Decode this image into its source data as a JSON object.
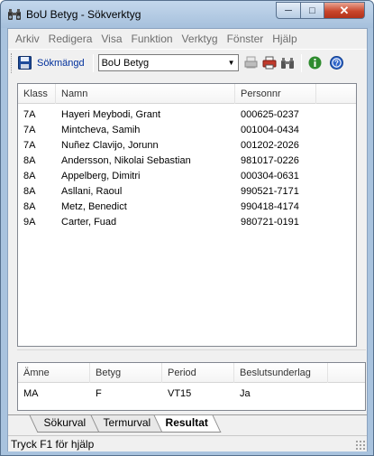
{
  "window": {
    "title": "BoU Betyg - Sökverktyg",
    "minimize_label": "─",
    "maximize_label": "□",
    "close_label": "✕"
  },
  "menubar": {
    "items": [
      "Arkiv",
      "Redigera",
      "Visa",
      "Funktion",
      "Verktyg",
      "Fönster",
      "Hjälp"
    ]
  },
  "toolbar": {
    "search_set_label": "Sökmängd",
    "combo_value": "BoU Betyg",
    "combo_arrow": "▼"
  },
  "results": {
    "columns": [
      "Klass",
      "Namn",
      "Personnr"
    ],
    "rows": [
      [
        "7A",
        "Hayeri Meybodi, Grant",
        "000625-0237"
      ],
      [
        "7A",
        "Mintcheva, Samih",
        "001004-0434"
      ],
      [
        "7A",
        "Nuñez Clavijo, Jorunn",
        "001202-2026"
      ],
      [
        "8A",
        "Andersson, Nikolai Sebastian",
        "981017-0226"
      ],
      [
        "8A",
        "Appelberg, Dimitri",
        "000304-0631"
      ],
      [
        "8A",
        "Asllani, Raoul",
        "990521-7171"
      ],
      [
        "8A",
        "Metz, Benedict",
        "990418-4174"
      ],
      [
        "9A",
        "Carter, Fuad",
        "980721-0191"
      ]
    ]
  },
  "grades": {
    "columns": [
      "Ämne",
      "Betyg",
      "Period",
      "Beslutsunderlag"
    ],
    "rows": [
      [
        "MA",
        "F",
        "VT15",
        "Ja"
      ]
    ]
  },
  "tabs": [
    "Sökurval",
    "Termurval",
    "Resultat"
  ],
  "active_tab": "Resultat",
  "status": {
    "text": "Tryck F1 för hjälp"
  },
  "colors": {
    "title_bar": "#a6c0dc",
    "close_button": "#c9462c",
    "link_text": "#00309c"
  }
}
